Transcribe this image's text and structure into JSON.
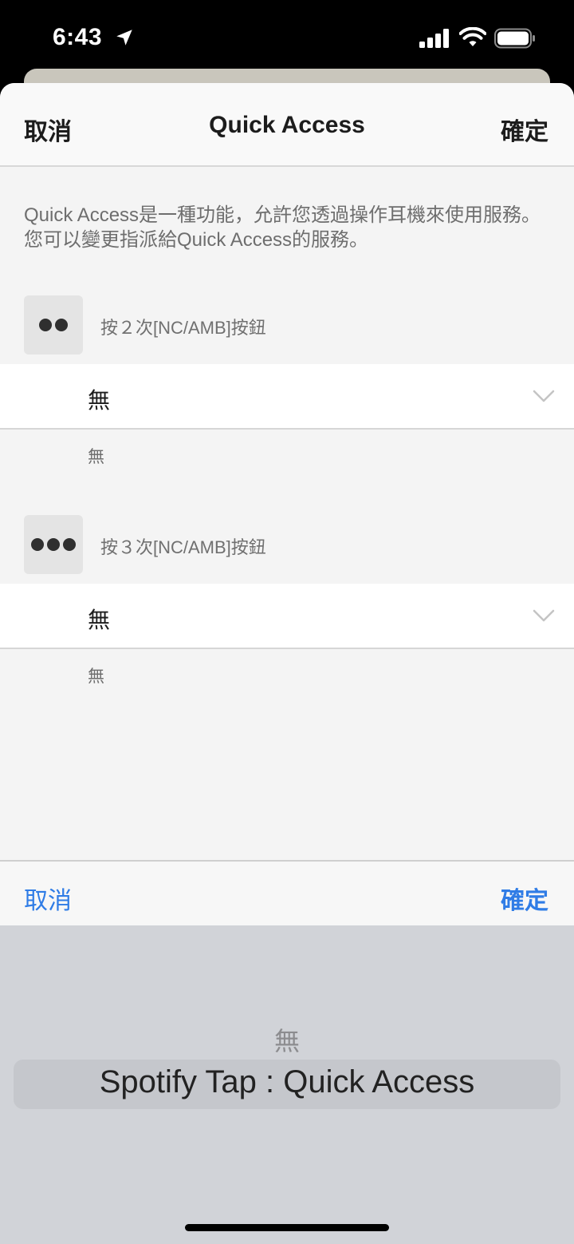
{
  "status_bar": {
    "time": "6:43"
  },
  "header": {
    "cancel": "取消",
    "title": "Quick Access",
    "confirm": "確定"
  },
  "description": "Quick Access是一種功能，允許您透過操作耳機來使用服務。您可以變更指派給Quick Access的服務。",
  "actions": [
    {
      "label": "按２次[NC/AMB]按鈕",
      "dots": 2,
      "selected": "無",
      "caption": "無"
    },
    {
      "label": "按３次[NC/AMB]按鈕",
      "dots": 3,
      "selected": "無",
      "caption": "無"
    }
  ],
  "picker": {
    "cancel": "取消",
    "confirm": "確定",
    "options": [
      "無",
      "Spotify Tap : Quick Access"
    ],
    "selected": "Spotify Tap : Quick Access"
  },
  "colors": {
    "accent": "#2f7ce6",
    "sheet_bg": "#f4f4f4",
    "picker_bg": "#d1d3d8"
  }
}
